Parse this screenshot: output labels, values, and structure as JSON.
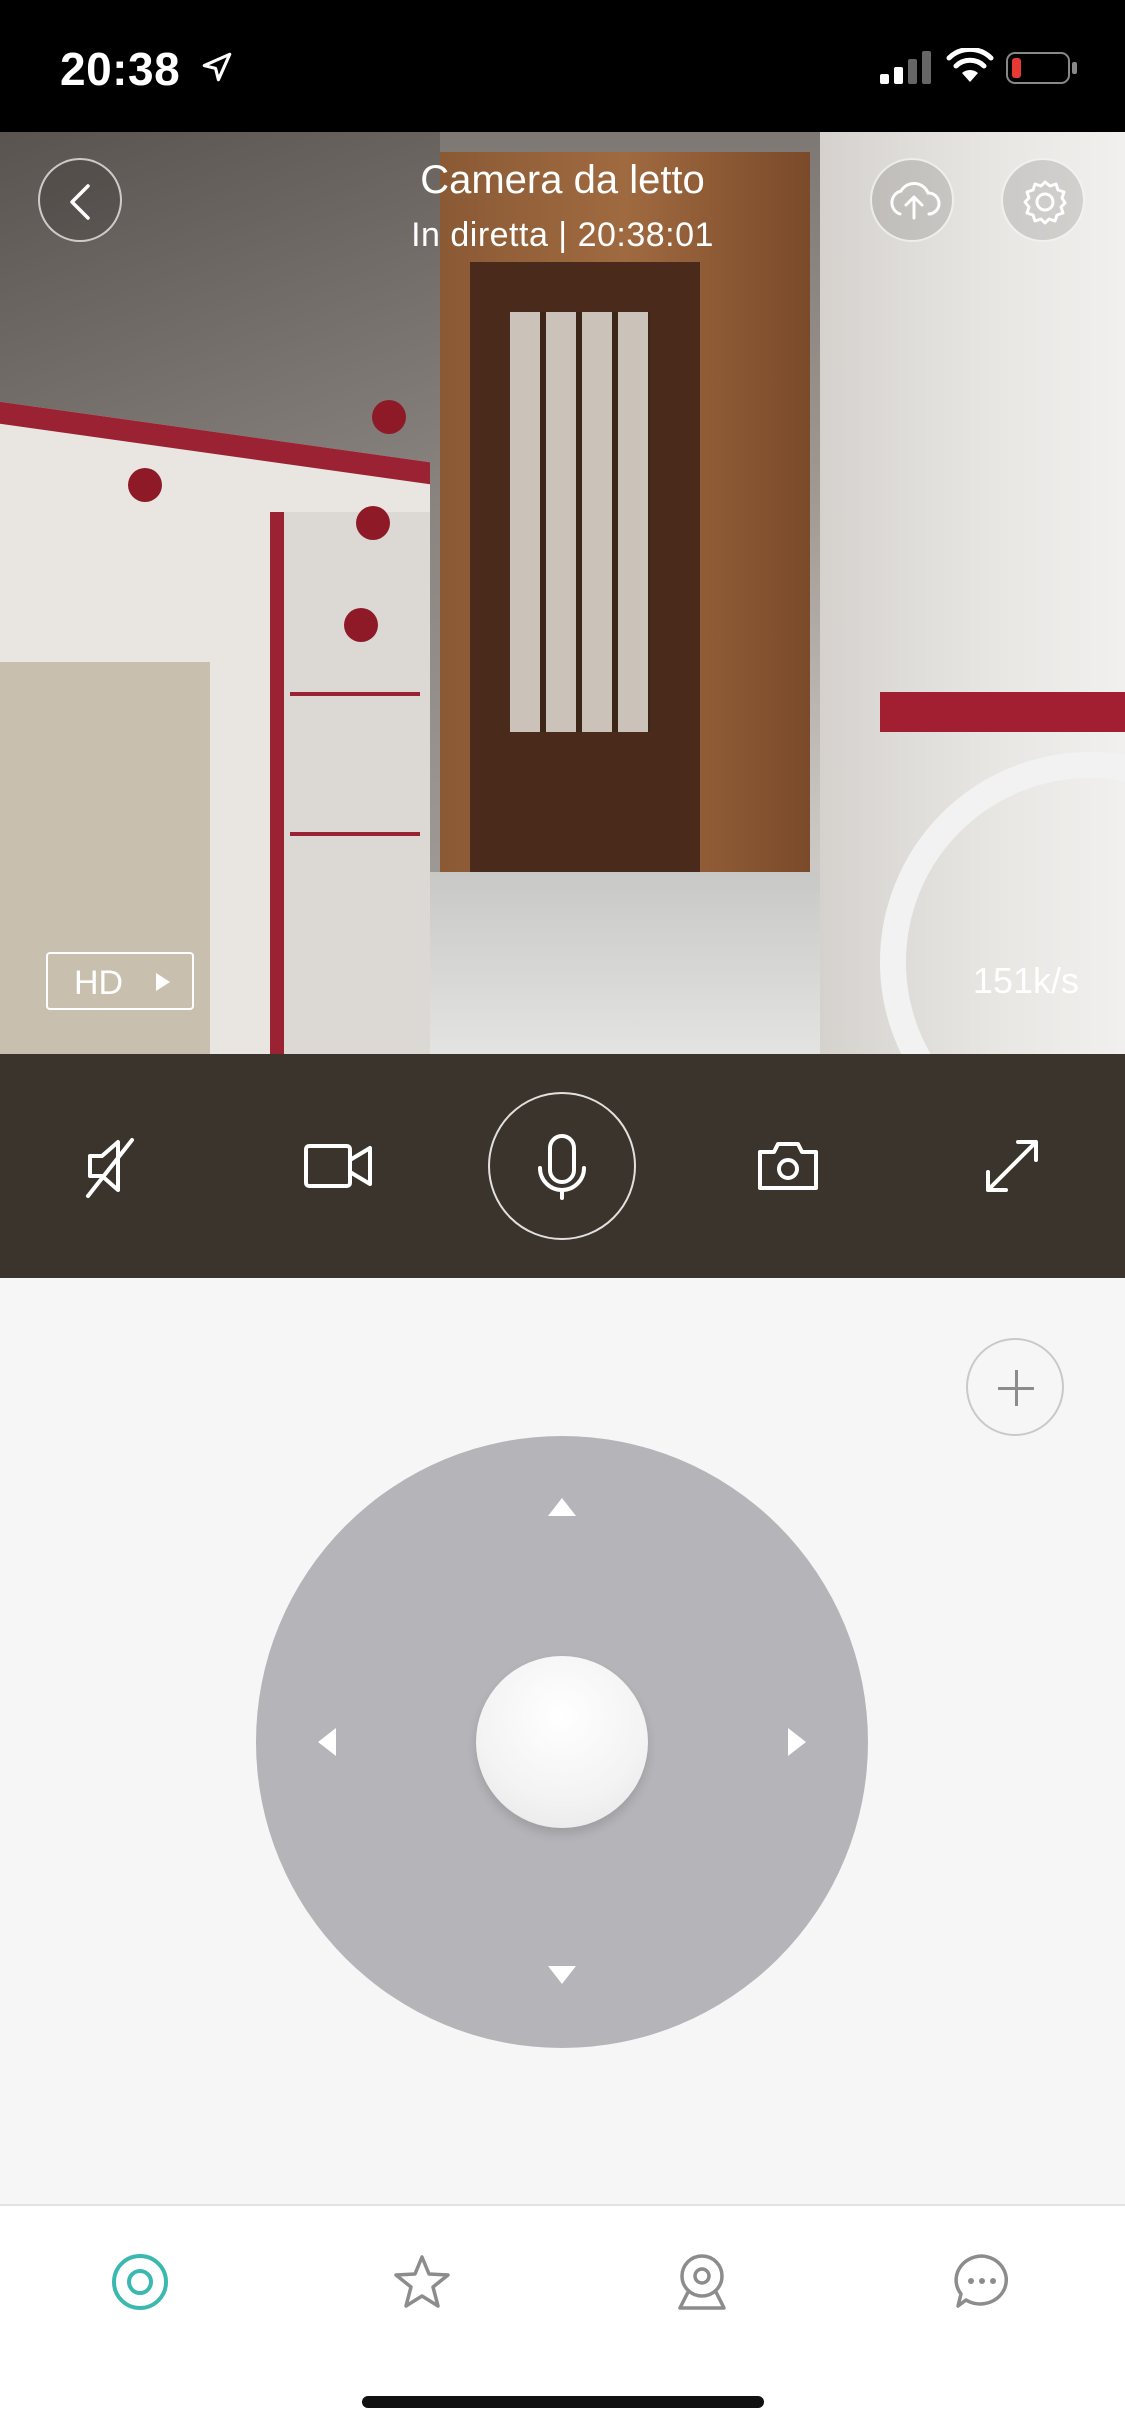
{
  "status_bar": {
    "time": "20:38",
    "icons": [
      "location-arrow-icon",
      "cellular-signal-icon",
      "wifi-icon",
      "battery-low-icon"
    ],
    "battery_color": "#e53935"
  },
  "camera": {
    "title": "Camera da letto",
    "subtitle": "In diretta | 20:38:01",
    "quality_label": "HD",
    "bitrate": "151k/s",
    "top_icons": [
      "back-icon",
      "cloud-upload-icon",
      "settings-icon"
    ]
  },
  "controls": {
    "icons": [
      "mute-speaker-icon",
      "video-record-icon",
      "microphone-icon",
      "camera-snapshot-icon",
      "fullscreen-icon"
    ],
    "bar_color": "#3a342c"
  },
  "ptz": {
    "icons": [
      "zoom-plus-icon",
      "arrow-up-icon",
      "arrow-down-icon",
      "arrow-left-icon",
      "arrow-right-icon"
    ],
    "pad_color": "#b4b4b9"
  },
  "tabs": {
    "icons": [
      "live-view-icon",
      "favorites-star-icon",
      "camera-device-icon",
      "messages-icon"
    ],
    "active_color": "#3bb8b0",
    "inactive_color": "#8c8c8c"
  }
}
